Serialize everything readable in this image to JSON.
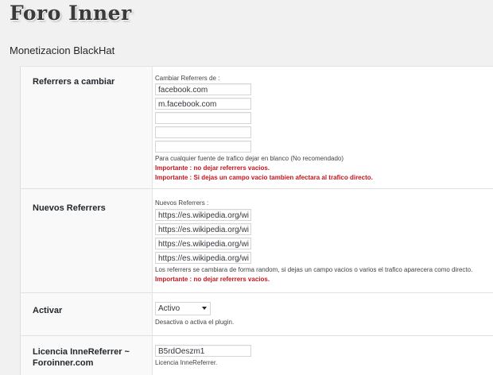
{
  "site": {
    "title": "Foro Inner"
  },
  "page": {
    "heading": "Monetizacion BlackHat"
  },
  "referrers": {
    "label": "Referrers a cambiar",
    "caption": "Cambiar Referrers de :",
    "inputs": [
      "facebook.com",
      "m.facebook.com",
      "",
      "",
      ""
    ],
    "help": "Para cualquier fuente de trafico dejar en blanco (No recomendado)",
    "warning1": "Importante : no dejar referrers vacios.",
    "warning2": "Importante : Si dejas un campo vacio tambien afectara al trafico directo."
  },
  "new_referrers": {
    "label": "Nuevos Referrers",
    "caption": "Nuevos Referrers :",
    "inputs": [
      "https://es.wikipedia.org/wi",
      "https://es.wikipedia.org/wi",
      "https://es.wikipedia.org/wi",
      "https://es.wikipedia.org/wi"
    ],
    "help": "Los referrers se cambiara de forma random, si dejas un campo vacios o varios el trafico aparecera como directo.",
    "warning": "Importante : no dejar referrers vacios."
  },
  "activate": {
    "label": "Activar",
    "selected": "Activo",
    "help": "Desactiva o activa el plugin."
  },
  "license": {
    "label": "Licencia InneReferrer ~ Foroinner.com",
    "value": "B5rdOeszm1",
    "help": "Licencia InneReferrer."
  }
}
